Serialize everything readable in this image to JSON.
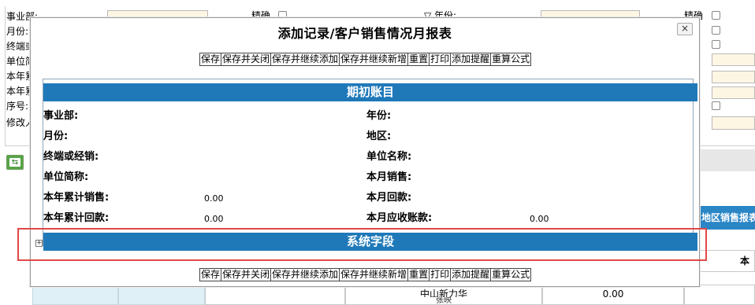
{
  "background": {
    "left_labels": [
      "事业部:",
      "月份:",
      "终端或",
      "单位简",
      "本年累",
      "本年累",
      "序号:",
      "修改人"
    ],
    "exact_label_1": "精确",
    "exact_label_2": "精确",
    "year_label": "年份:",
    "row_name": "中山新力华",
    "row_value": "0.00",
    "row_extra": "张映",
    "right_header": "地区销售报表",
    "right_sub": "本"
  },
  "dialog": {
    "title": "添加记录/客户销售情况月报表",
    "close": "×",
    "toolbar_top": [
      "保存",
      "保存并关闭",
      "保存并继续添加",
      "保存并继续新增",
      "重置",
      "打印",
      "添加提醒",
      "重算公式"
    ],
    "toolbar_bottom": [
      "保存",
      "保存并关闭",
      "保存并继续添加",
      "保存并继续新增",
      "重置",
      "打印",
      "添加提醒",
      "重算公式"
    ],
    "section1_title": "期初账目",
    "section2_title": "系统字段",
    "section2_expand": "+",
    "fields_left": [
      {
        "label": "事业部:",
        "value": ""
      },
      {
        "label": "月份:",
        "value": ""
      },
      {
        "label": "终端或经销:",
        "value": ""
      },
      {
        "label": "单位简称:",
        "value": ""
      },
      {
        "label": "本年累计销售:",
        "value": "0.00"
      },
      {
        "label": "本年累计回款:",
        "value": "0.00"
      }
    ],
    "fields_right": [
      {
        "label": "年份:",
        "value": ""
      },
      {
        "label": "地区:",
        "value": ""
      },
      {
        "label": "单位名称:",
        "value": ""
      },
      {
        "label": "本月销售:",
        "value": ""
      },
      {
        "label": "本月回款:",
        "value": ""
      },
      {
        "label": "本月应收账款:",
        "value": "0.00"
      }
    ]
  },
  "colors": {
    "section_bar": "#1f79b9",
    "highlight": "#e24848",
    "input_fill": "#fdf6e3"
  }
}
